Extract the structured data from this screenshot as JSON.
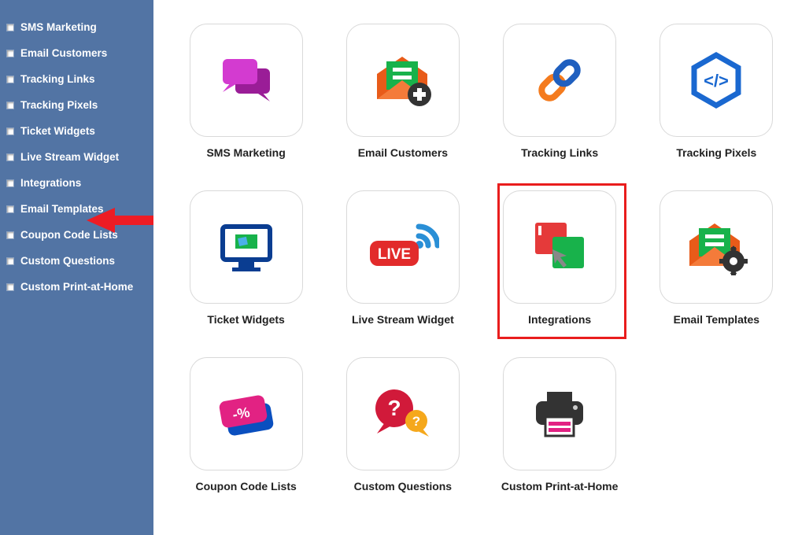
{
  "sidebar": {
    "items": [
      {
        "label": "SMS Marketing"
      },
      {
        "label": "Email Customers"
      },
      {
        "label": "Tracking Links"
      },
      {
        "label": "Tracking Pixels"
      },
      {
        "label": "Ticket Widgets"
      },
      {
        "label": "Live Stream Widget"
      },
      {
        "label": "Integrations"
      },
      {
        "label": "Email Templates"
      },
      {
        "label": "Coupon Code Lists"
      },
      {
        "label": "Custom Questions"
      },
      {
        "label": "Custom Print-at-Home"
      }
    ]
  },
  "tiles": [
    {
      "label": "SMS Marketing",
      "icon": "chat-bubbles"
    },
    {
      "label": "Email Customers",
      "icon": "envelope-plus"
    },
    {
      "label": "Tracking Links",
      "icon": "chain-link"
    },
    {
      "label": "Tracking Pixels",
      "icon": "code-hex"
    },
    {
      "label": "Ticket Widgets",
      "icon": "monitor-ticket"
    },
    {
      "label": "Live Stream Widget",
      "icon": "live-signal"
    },
    {
      "label": "Integrations",
      "icon": "squares-cursor",
      "highlighted": true
    },
    {
      "label": "Email Templates",
      "icon": "envelope-gear"
    },
    {
      "label": "Coupon Code Lists",
      "icon": "coupon-tickets"
    },
    {
      "label": "Custom Questions",
      "icon": "question-bubbles"
    },
    {
      "label": "Custom Print-at-Home",
      "icon": "printer"
    }
  ],
  "annotations": {
    "arrow_target": "Integrations",
    "highlight_target": "Integrations"
  },
  "colors": {
    "sidebar_bg": "#5274a4",
    "highlight": "#e91d1d",
    "arrow": "#ed1c24"
  }
}
